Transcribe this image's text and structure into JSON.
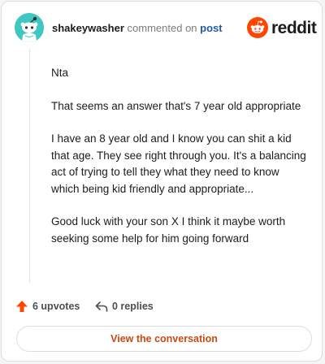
{
  "comment": {
    "username": "shakeywasher",
    "action_text": "commented on",
    "target_link": "post",
    "paragraphs": [
      "Nta",
      "That seems an answer that's 7 year old appropriate",
      "I have an 8 year old and I know you can shit a kid that age. They see right through you. It's a balancing act of trying to tell they what they need to know which being kid friendly and appropriate...",
      "Good luck with your son X I think it maybe worth seeking some help for him going forward"
    ]
  },
  "brand": {
    "logo_text": "reddit",
    "color": "#ff4500"
  },
  "actions": {
    "upvotes_label": "6 upvotes",
    "replies_label": "0 replies"
  },
  "cta": {
    "label": "View the conversation"
  },
  "icons": {
    "avatar": "snoo-avatar-icon",
    "logo": "reddit-logo-icon",
    "upvote": "upvote-arrow-icon",
    "reply": "reply-arrow-icon"
  }
}
